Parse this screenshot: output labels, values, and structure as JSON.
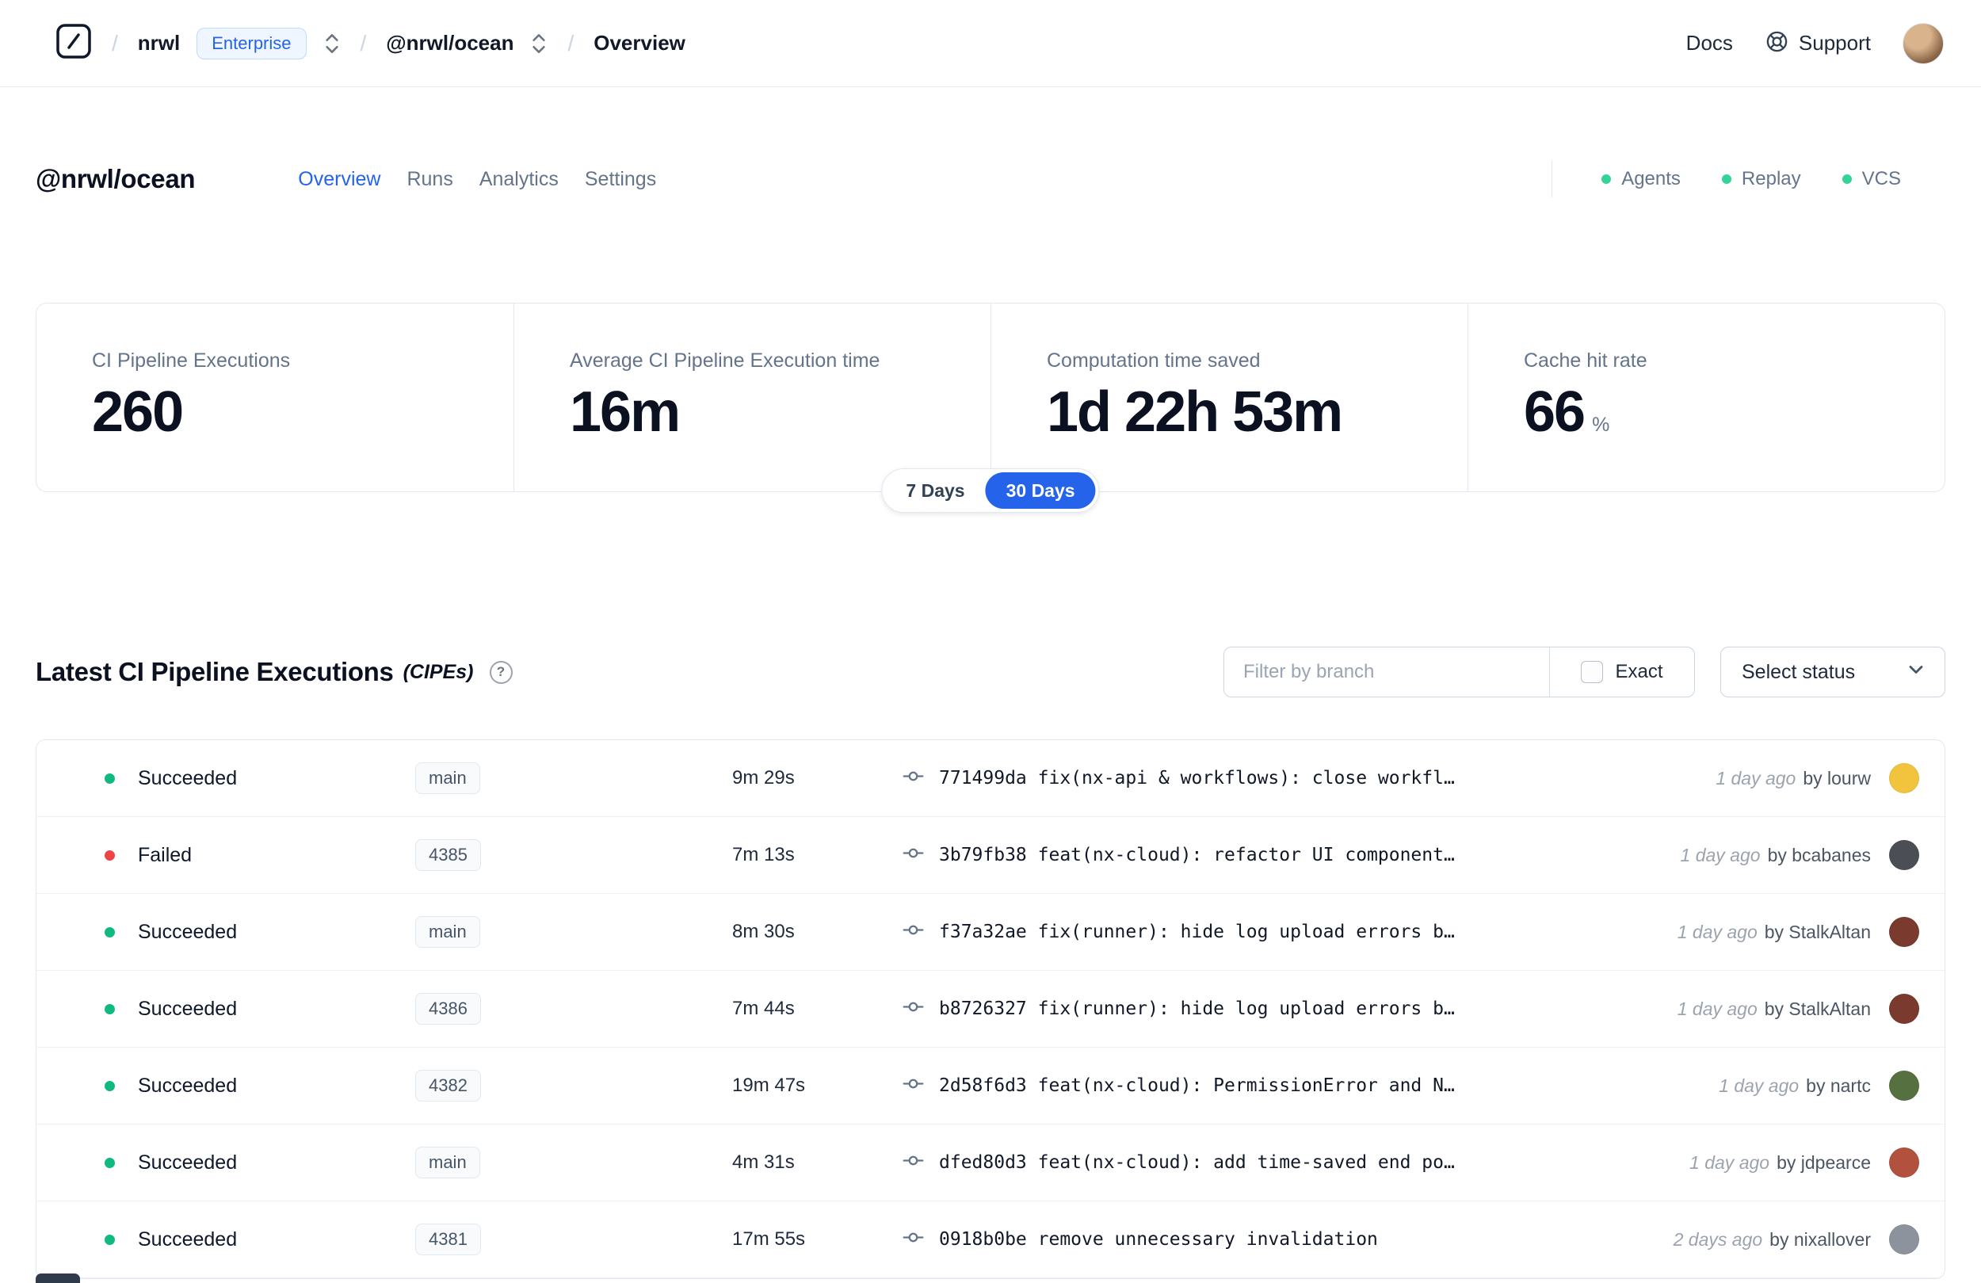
{
  "navbar": {
    "separator": "/",
    "org": "nrwl",
    "org_badge": "Enterprise",
    "workspace": "@nrwl/ocean",
    "page": "Overview",
    "docs_label": "Docs",
    "support_label": "Support"
  },
  "header": {
    "title": "@nrwl/ocean",
    "tabs": [
      {
        "label": "Overview",
        "active": true
      },
      {
        "label": "Runs",
        "active": false
      },
      {
        "label": "Analytics",
        "active": false
      },
      {
        "label": "Settings",
        "active": false
      }
    ],
    "indicators": [
      {
        "label": "Agents"
      },
      {
        "label": "Replay"
      },
      {
        "label": "VCS"
      }
    ]
  },
  "stats": {
    "cards": [
      {
        "label": "CI Pipeline Executions",
        "value": "260",
        "suffix": ""
      },
      {
        "label": "Average CI Pipeline Execution time",
        "value": "16m",
        "suffix": ""
      },
      {
        "label": "Computation time saved",
        "value": "1d 22h 53m",
        "suffix": ""
      },
      {
        "label": "Cache hit rate",
        "value": "66",
        "suffix": "%"
      }
    ],
    "range_toggle": {
      "options": [
        {
          "label": "7 Days",
          "selected": false
        },
        {
          "label": "30 Days",
          "selected": true
        }
      ]
    }
  },
  "cipes": {
    "title": "Latest CI Pipeline Executions",
    "title_suffix": "(CIPEs)",
    "filter_placeholder": "Filter by branch",
    "exact_label": "Exact",
    "status_button_label": "Select status",
    "rows": [
      {
        "status": "Succeeded",
        "status_color": "green",
        "branch": "main",
        "duration": "9m 29s",
        "commit": "771499da fix(nx-api & workflows): close workfl…",
        "time": "1 day ago",
        "author": "by lourw",
        "avatar_color": "#f2c43d"
      },
      {
        "status": "Failed",
        "status_color": "red",
        "branch": "4385",
        "duration": "7m 13s",
        "commit": "3b79fb38 feat(nx-cloud): refactor UI component…",
        "time": "1 day ago",
        "author": "by bcabanes",
        "avatar_color": "#4b4f55"
      },
      {
        "status": "Succeeded",
        "status_color": "green",
        "branch": "main",
        "duration": "8m 30s",
        "commit": "f37a32ae fix(runner): hide log upload errors b…",
        "time": "1 day ago",
        "author": "by StalkAltan",
        "avatar_color": "#7a3b2e"
      },
      {
        "status": "Succeeded",
        "status_color": "green",
        "branch": "4386",
        "duration": "7m 44s",
        "commit": "b8726327 fix(runner): hide log upload errors b…",
        "time": "1 day ago",
        "author": "by StalkAltan",
        "avatar_color": "#7a3b2e"
      },
      {
        "status": "Succeeded",
        "status_color": "green",
        "branch": "4382",
        "duration": "19m 47s",
        "commit": "2d58f6d3 feat(nx-cloud): PermissionError and N…",
        "time": "1 day ago",
        "author": "by nartc",
        "avatar_color": "#56703f"
      },
      {
        "status": "Succeeded",
        "status_color": "green",
        "branch": "main",
        "duration": "4m 31s",
        "commit": "dfed80d3 feat(nx-cloud): add time-saved end po…",
        "time": "1 day ago",
        "author": "by jdpearce",
        "avatar_color": "#b2523e"
      },
      {
        "status": "Succeeded",
        "status_color": "green",
        "branch": "4381",
        "duration": "17m 55s",
        "commit": "0918b0be remove unnecessary invalidation",
        "time": "2 days ago",
        "author": "by nixallover",
        "avatar_color": "#8d939c"
      }
    ]
  },
  "colors": {
    "accent_blue": "#2563eb",
    "success_green": "#10b981",
    "failed_red": "#ef4444",
    "indicator_green": "#34d399"
  }
}
